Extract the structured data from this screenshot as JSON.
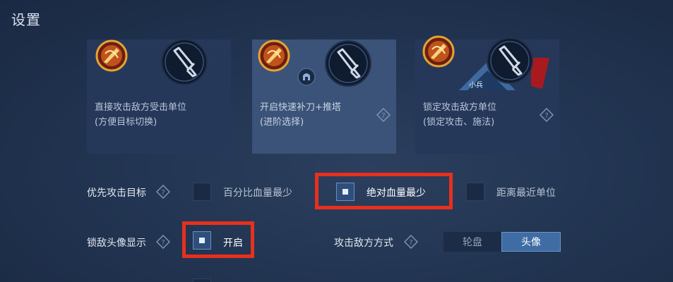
{
  "header": {
    "title": "设置"
  },
  "cards": [
    {
      "line1": "直接攻击敌方受击单位",
      "line2": "(方便目标切换)",
      "selected": false
    },
    {
      "line1": "开启快速补刀+推塔",
      "line2": "(进阶选择)",
      "selected": true
    },
    {
      "line1": "锁定攻击敌方单位",
      "line2": "(锁定攻击、施法)",
      "selected": false,
      "minion_label": "小兵"
    }
  ],
  "priority": {
    "label": "优先攻击目标",
    "options": [
      {
        "label": "百分比血量最少",
        "checked": false
      },
      {
        "label": "绝对血量最少",
        "checked": true
      },
      {
        "label": "距离最近单位",
        "checked": false
      }
    ]
  },
  "lock_avatar": {
    "label": "锁敌头像显示",
    "option": {
      "label": "开启",
      "checked": true
    }
  },
  "attack_mode": {
    "label": "攻击敌方方式",
    "segments": [
      {
        "label": "轮盘",
        "active": false
      },
      {
        "label": "头像",
        "active": true
      }
    ]
  },
  "colors": {
    "highlight": "#e8301d",
    "selected_card": "#3b5378",
    "active_segment": "#3f6ca3"
  }
}
